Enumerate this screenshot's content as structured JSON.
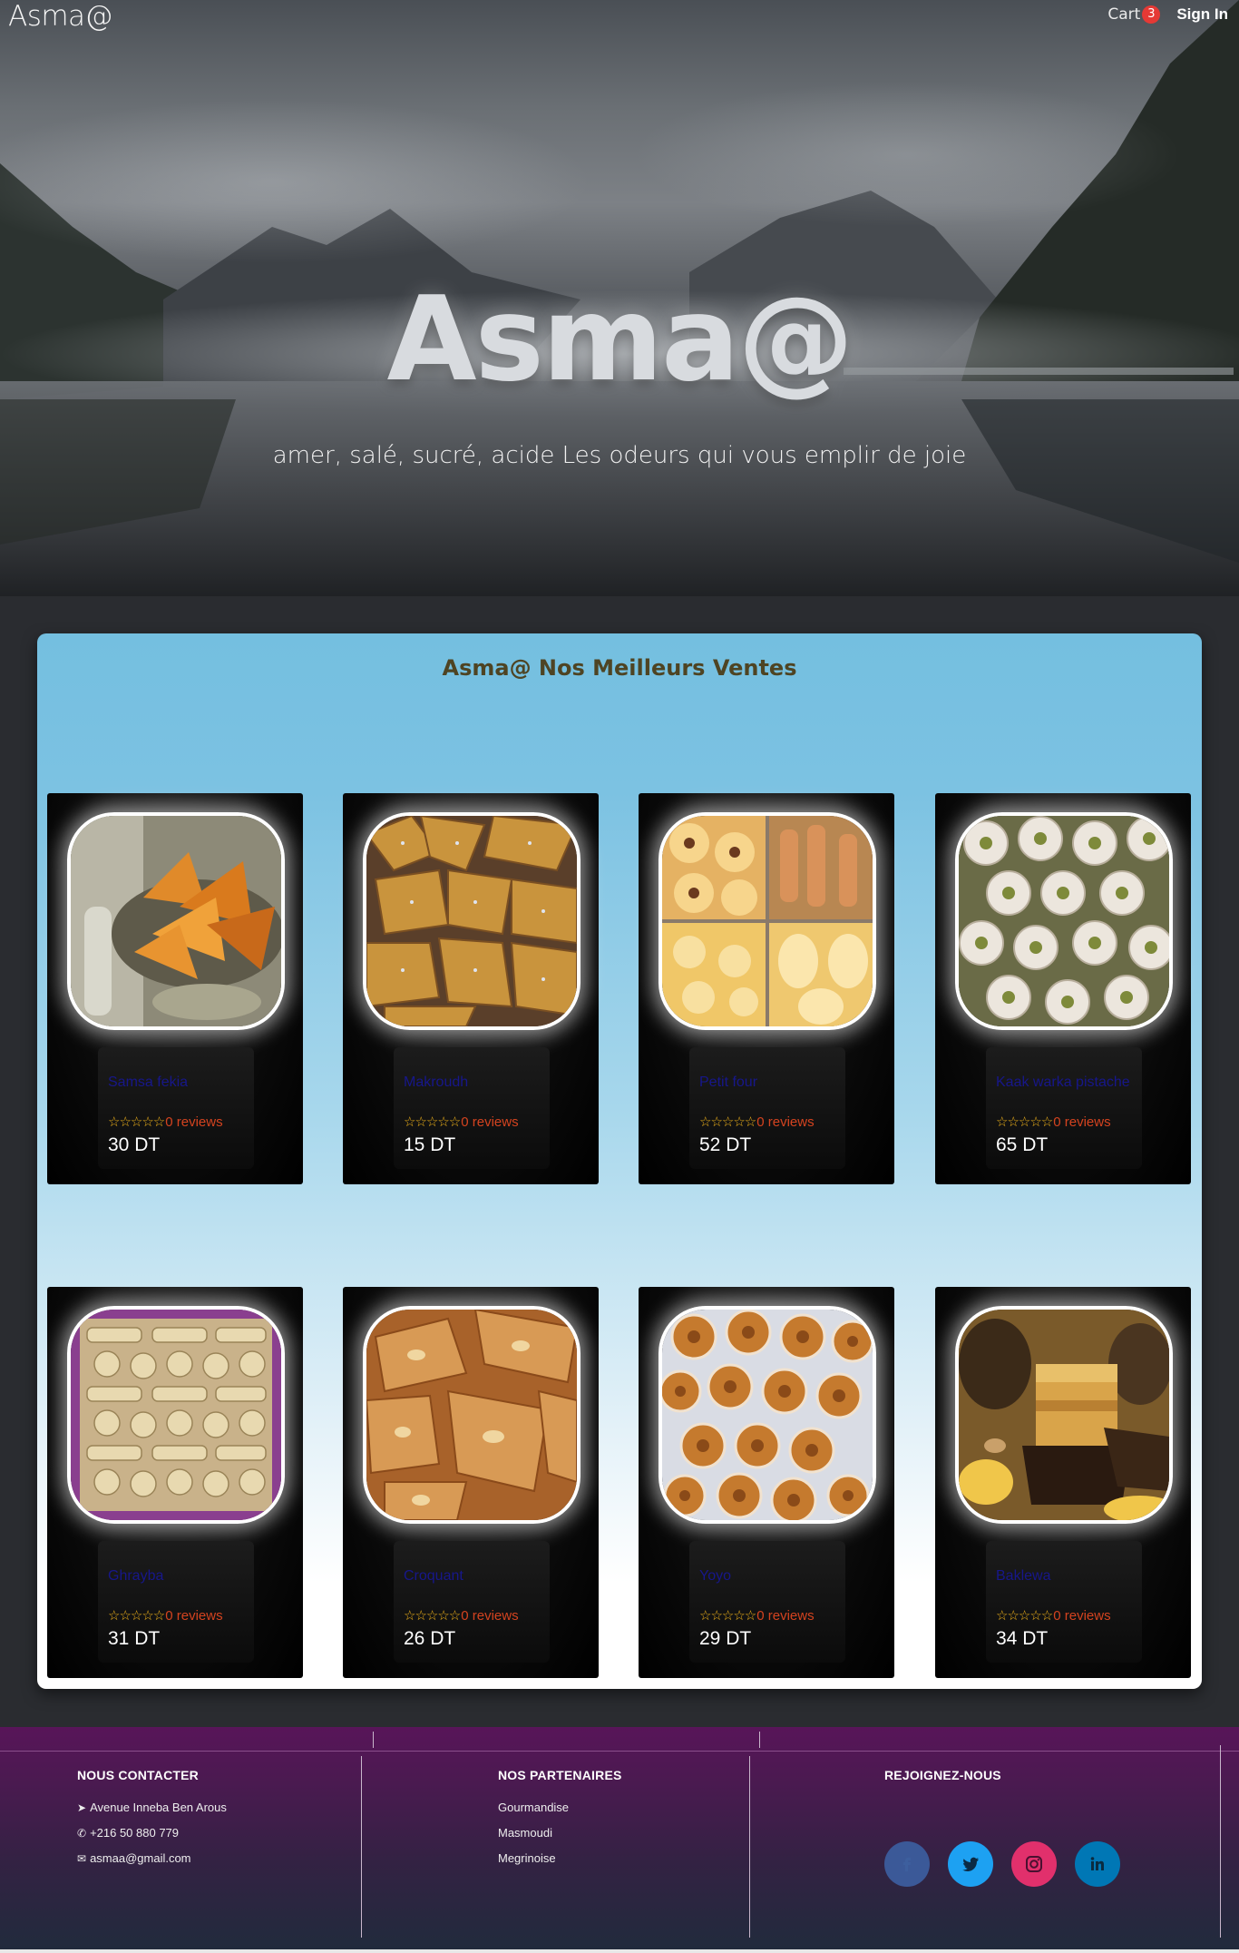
{
  "header": {
    "brand": "Asma@",
    "cart_label": "Cart",
    "cart_count": "3",
    "signin_label": "Sign In"
  },
  "hero": {
    "title": "Asma@",
    "subtitle": "amer, salé, sucré, acide Les odeurs qui vous emplir de joie"
  },
  "section": {
    "title": "Asma@ Nos Meilleurs Ventes"
  },
  "products": [
    {
      "name": "Samsa fekia",
      "stars": "☆☆☆☆☆",
      "reviews": "0 reviews",
      "price": "30 DT",
      "image": "samsa-photo",
      "rating_fraction": 0
    },
    {
      "name": "Makroudh",
      "stars": "☆☆☆☆☆",
      "reviews": "0 reviews",
      "price": "15 DT",
      "image": "makroudh-photo",
      "rating_fraction": 0
    },
    {
      "name": "Petit four",
      "stars": "☆☆☆☆☆",
      "reviews": "0 reviews",
      "price": "52 DT",
      "image": "petit-four-photo",
      "rating_fraction": 0
    },
    {
      "name": "Kaak warka pistache",
      "stars": "☆☆☆☆☆",
      "reviews": "0 reviews",
      "price": "65 DT",
      "image": "kaak-warka-photo",
      "rating_fraction": 0
    },
    {
      "name": "Ghrayba",
      "stars": "☆☆☆☆☆",
      "reviews": "0 reviews",
      "price": "31 DT",
      "image": "ghrayba-photo",
      "rating_fraction": 0
    },
    {
      "name": "Croquant",
      "stars": "☆☆☆☆☆",
      "reviews": "0 reviews",
      "price": "26 DT",
      "image": "croquant-photo",
      "rating_fraction": 0
    },
    {
      "name": "Yoyo",
      "stars": "☆☆☆☆☆",
      "reviews": "0 reviews",
      "price": "29 DT",
      "image": "yoyo-photo",
      "rating_fraction": 0
    },
    {
      "name": "Baklewa",
      "stars": "☆☆☆☆☆",
      "reviews": "0 reviews",
      "price": "34 DT",
      "image": "baklewa-photo",
      "rating_fraction": 0
    }
  ],
  "footer": {
    "contact": {
      "title": "NOUS CONTACTER",
      "address": "Avenue Inneba Ben Arous",
      "phone": "+216 50 880 779",
      "email": "asmaa@gmail.com"
    },
    "partners": {
      "title": "NOS PARTENAIRES",
      "items": [
        "Gourmandise",
        "Masmoudi",
        "Megrinoise"
      ]
    },
    "join": {
      "title": "REJOIGNEZ-NOUS",
      "socials": [
        "facebook-icon",
        "twitter-icon",
        "instagram-icon",
        "linkedin-icon"
      ]
    }
  },
  "colors": {
    "accent_badge": "#e53935",
    "panel_top": "#74bfe0",
    "panel_title": "#4e4423",
    "product_name": "#17178a",
    "reviews": "#d4431f",
    "stars": "#f0b21a",
    "footer_top": "#581559",
    "footer_bottom": "#202b3c",
    "facebook": "#3b5998",
    "twitter": "#1da1f2",
    "instagram": "#e1306c",
    "linkedin": "#0077b5"
  }
}
